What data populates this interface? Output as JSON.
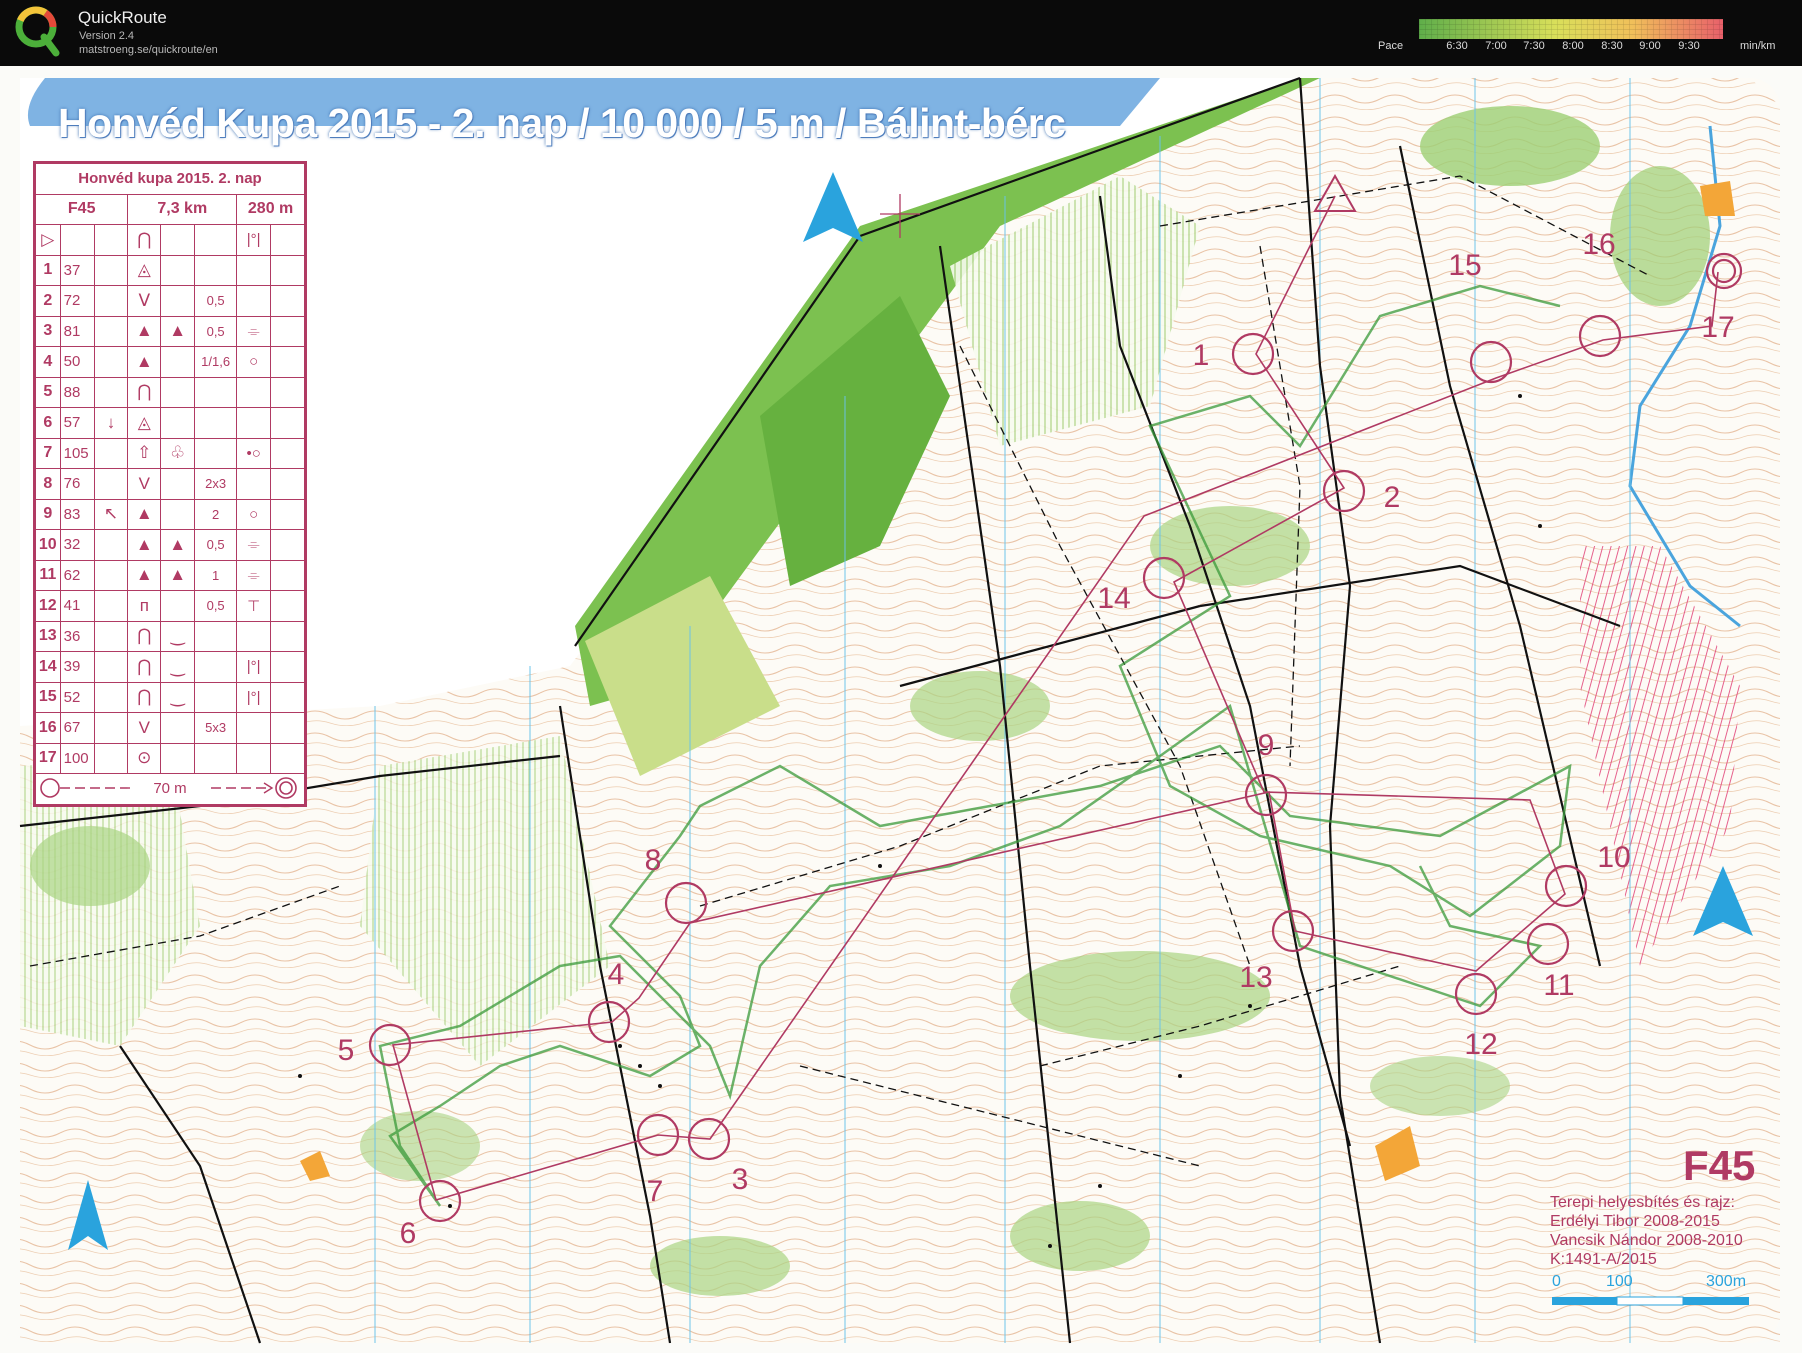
{
  "app": {
    "name": "QuickRoute",
    "version": "Version 2.4",
    "url": "matstroeng.se/quickroute/en"
  },
  "pace_legend": {
    "label": "Pace",
    "unit": "min/km",
    "ticks": [
      "6:30",
      "7:00",
      "7:30",
      "8:00",
      "8:30",
      "9:00",
      "9:30"
    ],
    "color_from": "#5fae4a",
    "color_mid": "#e9e15a",
    "color_to": "#e8606a"
  },
  "map": {
    "title": "Honvéd Kupa 2015 - 2. nap / 10 000 / 5 m / Bálint-bérc",
    "course": "F45",
    "credits": [
      "Terepi helyesbítés és rajz:",
      "Erdélyi Tibor      2008-2015",
      "Vancsik Nándor 2008-2010",
      "K:1491-A/2015"
    ],
    "scale": {
      "s0": "0",
      "s1": "100",
      "s2": "300m"
    },
    "colors": {
      "course": "#b03a63",
      "forest_green": "#7cc150",
      "contour": "#c8824a",
      "north": "#2aa3dd"
    },
    "control_numbers": [
      "1",
      "2",
      "3",
      "4",
      "5",
      "6",
      "7",
      "8",
      "9",
      "10",
      "11",
      "12",
      "13",
      "14",
      "15",
      "16",
      "17"
    ]
  },
  "control_description": {
    "title": "Honvéd kupa 2015. 2. nap",
    "class": "F45",
    "length": "7,3 km",
    "climb": "280 m",
    "rows": [
      {
        "n": "1",
        "code": "37",
        "dir": "",
        "feat": "◬",
        "d1": "",
        "d2": "",
        "app": ""
      },
      {
        "n": "2",
        "code": "72",
        "dir": "",
        "feat": "ᐯ",
        "d1": "",
        "d2": "0,5",
        "app": ""
      },
      {
        "n": "3",
        "code": "81",
        "dir": "",
        "feat": "▲",
        "d1": "▲",
        "d2": "0,5",
        "app": "⌯"
      },
      {
        "n": "4",
        "code": "50",
        "dir": "",
        "feat": "▲",
        "d1": "",
        "d2": "1/1,6",
        "app": "○"
      },
      {
        "n": "5",
        "code": "88",
        "dir": "",
        "feat": "⋂",
        "d1": "",
        "d2": "",
        "app": ""
      },
      {
        "n": "6",
        "code": "57",
        "dir": "↓",
        "feat": "◬",
        "d1": "",
        "d2": "",
        "app": ""
      },
      {
        "n": "7",
        "code": "105",
        "dir": "",
        "feat": "⇧",
        "d1": "♧",
        "d2": "",
        "app": "•○"
      },
      {
        "n": "8",
        "code": "76",
        "dir": "",
        "feat": "V",
        "d1": "",
        "d2": "2x3",
        "app": ""
      },
      {
        "n": "9",
        "code": "83",
        "dir": "↖",
        "feat": "▲",
        "d1": "",
        "d2": "2",
        "app": "○"
      },
      {
        "n": "10",
        "code": "32",
        "dir": "",
        "feat": "▲",
        "d1": "▲",
        "d2": "0,5",
        "app": "⌯"
      },
      {
        "n": "11",
        "code": "62",
        "dir": "",
        "feat": "▲",
        "d1": "▲",
        "d2": "1",
        "app": "⌯"
      },
      {
        "n": "12",
        "code": "41",
        "dir": "",
        "feat": "ᴨ",
        "d1": "",
        "d2": "0,5",
        "app": "⊤"
      },
      {
        "n": "13",
        "code": "36",
        "dir": "",
        "feat": "⋂",
        "d1": "‿",
        "d2": "",
        "app": ""
      },
      {
        "n": "14",
        "code": "39",
        "dir": "",
        "feat": "⋂",
        "d1": "‿",
        "d2": "",
        "app": "|°|"
      },
      {
        "n": "15",
        "code": "52",
        "dir": "",
        "feat": "⋂",
        "d1": "‿",
        "d2": "",
        "app": "|°|"
      },
      {
        "n": "16",
        "code": "67",
        "dir": "",
        "feat": "V",
        "d1": "",
        "d2": "5x3",
        "app": ""
      },
      {
        "n": "17",
        "code": "100",
        "dir": "",
        "feat": "⊙",
        "d1": "",
        "d2": "",
        "app": ""
      }
    ],
    "start_row": {
      "n": "▷",
      "feat": "⋂",
      "app": "|°|"
    },
    "finish": "70 m"
  }
}
